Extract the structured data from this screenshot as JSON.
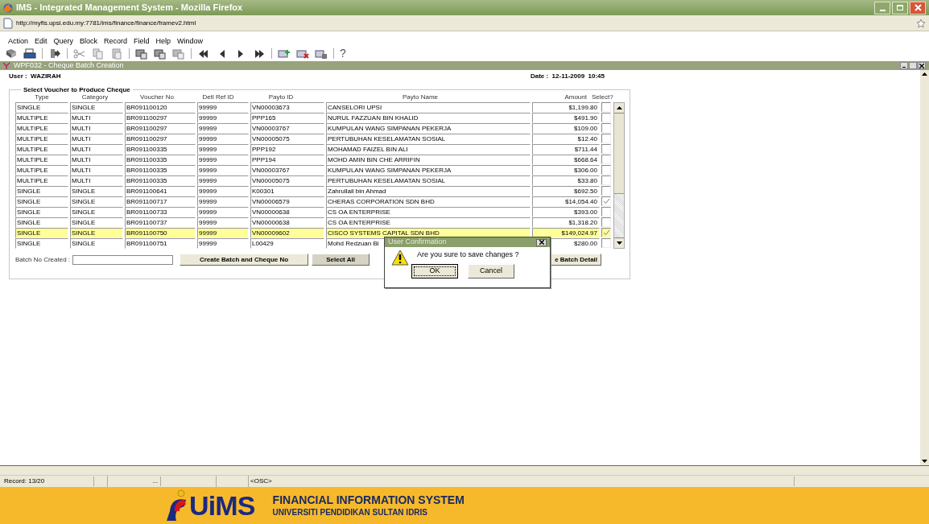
{
  "window": {
    "title": "IMS - Integrated Management System - Mozilla Firefox"
  },
  "address_bar": {
    "url": "http://myfis.upsi.edu.my:7781/ims/finance/finance/framev2.html"
  },
  "menu": [
    "Action",
    "Edit",
    "Query",
    "Block",
    "Record",
    "Field",
    "Help",
    "Window"
  ],
  "toolbar": {
    "help": "?"
  },
  "form": {
    "title": "WPF032 - Cheque Batch Creation",
    "user_label": "User :",
    "user": "WAZIRAH",
    "date_label": "Date :",
    "date": "12-11-2009  10:45",
    "section": "Select Voucher to Produce Cheque",
    "columns": [
      "Type",
      "Category",
      "Voucher No",
      "Detl Ref ID",
      "Payto ID",
      "Payto Name",
      "Amount",
      "Select?"
    ],
    "rows": [
      {
        "cells": [
          "SINGLE",
          "SINGLE",
          "BR091100120",
          "99999",
          "VN00003673",
          "CANSELORI UPSI",
          "$1,199.80"
        ],
        "checked": false,
        "selected": false
      },
      {
        "cells": [
          "MULTIPLE",
          "MULTI",
          "BR091100297",
          "99999",
          "PPP165",
          "NURUL FAZZUAN BIN KHALID",
          "$491.90"
        ],
        "checked": false,
        "selected": false
      },
      {
        "cells": [
          "MULTIPLE",
          "MULTI",
          "BR091100297",
          "99999",
          "VN00003767",
          "KUMPULAN WANG SIMPANAN PEKERJA",
          "$109.00"
        ],
        "checked": false,
        "selected": false
      },
      {
        "cells": [
          "MULTIPLE",
          "MULTI",
          "BR091100297",
          "99999",
          "VN00005075",
          "PERTUBUHAN KESELAMATAN SOSIAL",
          "$12.40"
        ],
        "checked": false,
        "selected": false
      },
      {
        "cells": [
          "MULTIPLE",
          "MULTI",
          "BR091100335",
          "99999",
          "PPP192",
          "MOHAMAD FAIZEL BIN ALI",
          "$711.44"
        ],
        "checked": false,
        "selected": false
      },
      {
        "cells": [
          "MULTIPLE",
          "MULTI",
          "BR091100335",
          "99999",
          "PPP194",
          "MOHD AMIN BIN CHE ARRIFIN",
          "$668.64"
        ],
        "checked": false,
        "selected": false
      },
      {
        "cells": [
          "MULTIPLE",
          "MULTI",
          "BR091100335",
          "99999",
          "VN00003767",
          "KUMPULAN WANG SIMPANAN PEKERJA",
          "$306.00"
        ],
        "checked": false,
        "selected": false
      },
      {
        "cells": [
          "MULTIPLE",
          "MULTI",
          "BR091100335",
          "99999",
          "VN00005075",
          "PERTUBUHAN KESELAMATAN SOSIAL",
          "$33.80"
        ],
        "checked": false,
        "selected": false
      },
      {
        "cells": [
          "SINGLE",
          "SINGLE",
          "BR091100641",
          "99999",
          "K00301",
          "Zahrullail bin Ahmad",
          "$692.50"
        ],
        "checked": false,
        "selected": false
      },
      {
        "cells": [
          "SINGLE",
          "SINGLE",
          "BR091100717",
          "99999",
          "VN00006579",
          "CHERAS CORPORATION SDN BHD",
          "$14,054.40"
        ],
        "checked": true,
        "selected": false
      },
      {
        "cells": [
          "SINGLE",
          "SINGLE",
          "BR091100733",
          "99999",
          "VN00000638",
          "CS OA ENTERPRISE",
          "$393.00"
        ],
        "checked": false,
        "selected": false
      },
      {
        "cells": [
          "SINGLE",
          "SINGLE",
          "BR091100737",
          "99999",
          "VN00000638",
          "CS OA ENTERPRISE",
          "$1,318.20"
        ],
        "checked": false,
        "selected": false
      },
      {
        "cells": [
          "SINGLE",
          "SINGLE",
          "BR091100750",
          "99999",
          "VN00009602",
          "CISCO SYSTEMS CAPITAL SDN BHD",
          "$149,024.97"
        ],
        "checked": true,
        "selected": true
      },
      {
        "cells": [
          "SINGLE",
          "SINGLE",
          "BR091100751",
          "99999",
          "L00429",
          "Mohd Redzuan Bi",
          "$280.00"
        ],
        "checked": false,
        "selected": false
      }
    ],
    "batch_label": "Batch No Created :",
    "buttons": [
      "Create Batch and Cheque No",
      "Select All",
      "e Batch Detail"
    ]
  },
  "dialog": {
    "title": "User Confirmation",
    "message": "Are you sure to save changes ?",
    "buttons": [
      {
        "label": "OK",
        "selected": true
      },
      {
        "label": "Cancel",
        "selected": false
      }
    ]
  },
  "status_bar": {
    "record": "Record: 13/20",
    "field": "...",
    "mode": "<OSC>"
  },
  "banner": {
    "logo": "UiMS",
    "title": "FINANCIAL INFORMATION SYSTEM",
    "subtitle": "UNIVERSITI PENDIDIKAN SULTAN IDRIS"
  }
}
